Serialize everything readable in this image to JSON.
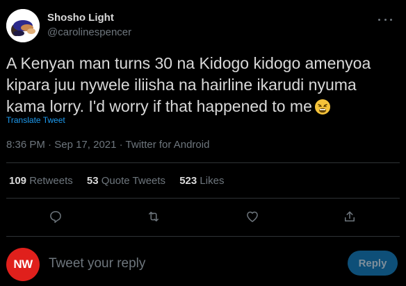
{
  "author": {
    "display_name": "Shosho Light",
    "handle": "@carolinespencer"
  },
  "tweet": {
    "text": "A Kenyan man turns 30 na Kidogo kidogo amenyoa kipara juu nywele iliisha na hairline ikarudi nyuma kama lorry. I'd worry if that happened to me",
    "emoji": "weary-face",
    "translate_label": "Translate Tweet",
    "time": "8:36 PM",
    "date": "Sep 17, 2021",
    "source": "Twitter for Android",
    "separator": "·"
  },
  "stats": {
    "retweets_count": "109",
    "retweets_label": "Retweets",
    "quote_count": "53",
    "quote_label": "Quote Tweets",
    "likes_count": "523",
    "likes_label": "Likes"
  },
  "actions": [
    "reply-icon",
    "retweet-icon",
    "like-icon",
    "share-icon"
  ],
  "reply": {
    "avatar_text": "NW",
    "placeholder": "Tweet your reply",
    "button_label": "Reply"
  },
  "colors": {
    "background": "#000000",
    "text": "#d9d9d9",
    "muted": "#6e767d",
    "link": "#1d9bf0",
    "reply_button": "#0e4f78",
    "reply_avatar": "#e0201c"
  }
}
